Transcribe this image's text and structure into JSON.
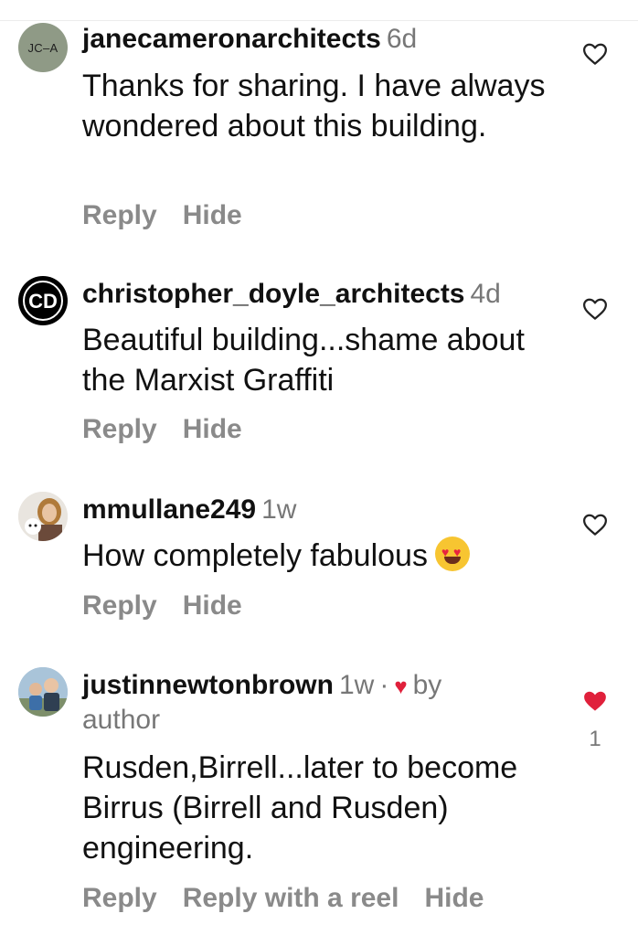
{
  "comments": [
    {
      "avatar_text": "JC–A",
      "username": "janecameronarchitects",
      "time": "6d",
      "text": "Thanks for sharing. I have always wondered about this building.",
      "actions": [
        "Reply",
        "Hide"
      ]
    },
    {
      "avatar_logo": "CD",
      "username": "christopher_doyle_architects",
      "time": "4d",
      "text": "Beautiful building...shame about the Marxist Graffiti",
      "actions": [
        "Reply",
        "Hide"
      ]
    },
    {
      "username": "mmullane249",
      "time": "1w",
      "text": "How completely fabulous",
      "actions": [
        "Reply",
        "Hide"
      ]
    },
    {
      "username": "justinnewtonbrown",
      "time": "1w",
      "separator": "·",
      "by_author_label": "by author",
      "text": "Rusden,Birrell...later to become Birrus (Birrell and Rusden) engineering.",
      "actions": [
        "Reply",
        "Reply with a reel",
        "Hide"
      ],
      "like_count": "1"
    }
  ],
  "colors": {
    "liked": "#e0203b",
    "secondary_text": "#777777",
    "action_text": "#8a8a8a"
  }
}
